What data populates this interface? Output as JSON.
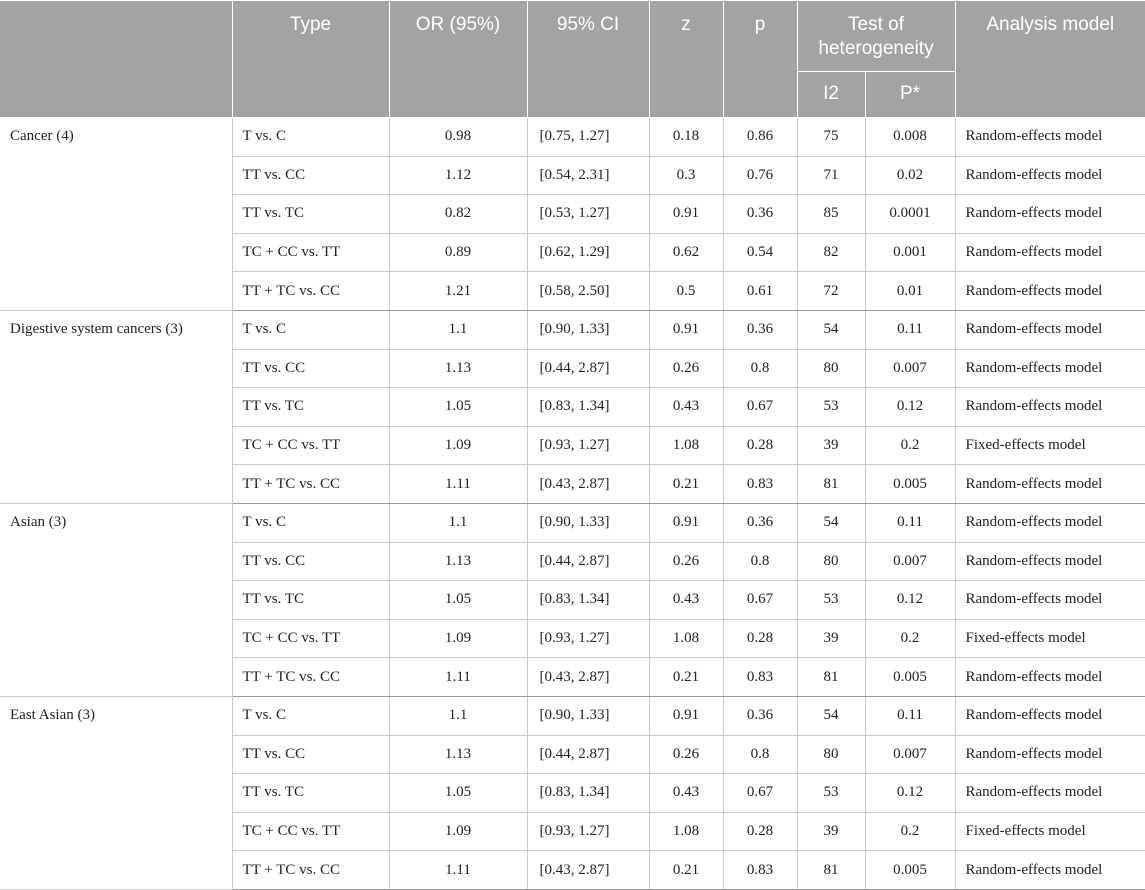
{
  "header": {
    "type": "Type",
    "or": "OR (95%)",
    "ci": "95% CI",
    "z": "z",
    "p": "p",
    "heterogeneity": "Test of heterogeneity",
    "i2": "I2",
    "pstar": "P*",
    "model": "Analysis model"
  },
  "groups": [
    {
      "name": "Cancer (4)",
      "rows": [
        {
          "type": "T vs. C",
          "or": "0.98",
          "ci": "[0.75, 1.27]",
          "z": "0.18",
          "p": "0.86",
          "i2": "75",
          "pstar": "0.008",
          "model": "Random-effects model"
        },
        {
          "type": "TT vs. CC",
          "or": "1.12",
          "ci": "[0.54, 2.31]",
          "z": "0.3",
          "p": "0.76",
          "i2": "71",
          "pstar": "0.02",
          "model": "Random-effects model"
        },
        {
          "type": "TT vs. TC",
          "or": "0.82",
          "ci": "[0.53, 1.27]",
          "z": "0.91",
          "p": "0.36",
          "i2": "85",
          "pstar": "0.0001",
          "model": "Random-effects model"
        },
        {
          "type": "TC + CC vs. TT",
          "or": "0.89",
          "ci": "[0.62, 1.29]",
          "z": "0.62",
          "p": "0.54",
          "i2": "82",
          "pstar": "0.001",
          "model": "Random-effects model"
        },
        {
          "type": "TT + TC vs. CC",
          "or": "1.21",
          "ci": "[0.58, 2.50]",
          "z": "0.5",
          "p": "0.61",
          "i2": "72",
          "pstar": "0.01",
          "model": "Random-effects model"
        }
      ]
    },
    {
      "name": "Digestive system cancers (3)",
      "rows": [
        {
          "type": "T vs. C",
          "or": "1.1",
          "ci": "[0.90, 1.33]",
          "z": "0.91",
          "p": "0.36",
          "i2": "54",
          "pstar": "0.11",
          "model": "Random-effects model"
        },
        {
          "type": "TT vs. CC",
          "or": "1.13",
          "ci": "[0.44, 2.87]",
          "z": "0.26",
          "p": "0.8",
          "i2": "80",
          "pstar": "0.007",
          "model": "Random-effects model"
        },
        {
          "type": "TT vs. TC",
          "or": "1.05",
          "ci": "[0.83, 1.34]",
          "z": "0.43",
          "p": "0.67",
          "i2": "53",
          "pstar": "0.12",
          "model": "Random-effects model"
        },
        {
          "type": "TC + CC vs. TT",
          "or": "1.09",
          "ci": "[0.93, 1.27]",
          "z": "1.08",
          "p": "0.28",
          "i2": "39",
          "pstar": "0.2",
          "model": "Fixed-effects model"
        },
        {
          "type": "TT + TC vs. CC",
          "or": "1.11",
          "ci": "[0.43, 2.87]",
          "z": "0.21",
          "p": "0.83",
          "i2": "81",
          "pstar": "0.005",
          "model": "Random-effects model"
        }
      ]
    },
    {
      "name": "Asian (3)",
      "rows": [
        {
          "type": "T vs. C",
          "or": "1.1",
          "ci": "[0.90, 1.33]",
          "z": "0.91",
          "p": "0.36",
          "i2": "54",
          "pstar": "0.11",
          "model": "Random-effects model"
        },
        {
          "type": "TT vs. CC",
          "or": "1.13",
          "ci": "[0.44, 2.87]",
          "z": "0.26",
          "p": "0.8",
          "i2": "80",
          "pstar": "0.007",
          "model": "Random-effects model"
        },
        {
          "type": "TT vs. TC",
          "or": "1.05",
          "ci": "[0.83, 1.34]",
          "z": "0.43",
          "p": "0.67",
          "i2": "53",
          "pstar": "0.12",
          "model": "Random-effects model"
        },
        {
          "type": "TC + CC vs. TT",
          "or": "1.09",
          "ci": "[0.93, 1.27]",
          "z": "1.08",
          "p": "0.28",
          "i2": "39",
          "pstar": "0.2",
          "model": "Fixed-effects model"
        },
        {
          "type": "TT + TC vs. CC",
          "or": "1.11",
          "ci": "[0.43, 2.87]",
          "z": "0.21",
          "p": "0.83",
          "i2": "81",
          "pstar": "0.005",
          "model": "Random-effects model"
        }
      ]
    },
    {
      "name": "East Asian (3)",
      "rows": [
        {
          "type": "T vs. C",
          "or": "1.1",
          "ci": "[0.90, 1.33]",
          "z": "0.91",
          "p": "0.36",
          "i2": "54",
          "pstar": "0.11",
          "model": "Random-effects model"
        },
        {
          "type": "TT vs. CC",
          "or": "1.13",
          "ci": "[0.44, 2.87]",
          "z": "0.26",
          "p": "0.8",
          "i2": "80",
          "pstar": "0.007",
          "model": "Random-effects model"
        },
        {
          "type": "TT vs. TC",
          "or": "1.05",
          "ci": "[0.83, 1.34]",
          "z": "0.43",
          "p": "0.67",
          "i2": "53",
          "pstar": "0.12",
          "model": "Random-effects model"
        },
        {
          "type": "TC + CC vs. TT",
          "or": "1.09",
          "ci": "[0.93, 1.27]",
          "z": "1.08",
          "p": "0.28",
          "i2": "39",
          "pstar": "0.2",
          "model": "Fixed-effects model"
        },
        {
          "type": "TT + TC vs. CC",
          "or": "1.11",
          "ci": "[0.43, 2.87]",
          "z": "0.21",
          "p": "0.83",
          "i2": "81",
          "pstar": "0.005",
          "model": "Random-effects model"
        }
      ]
    }
  ]
}
